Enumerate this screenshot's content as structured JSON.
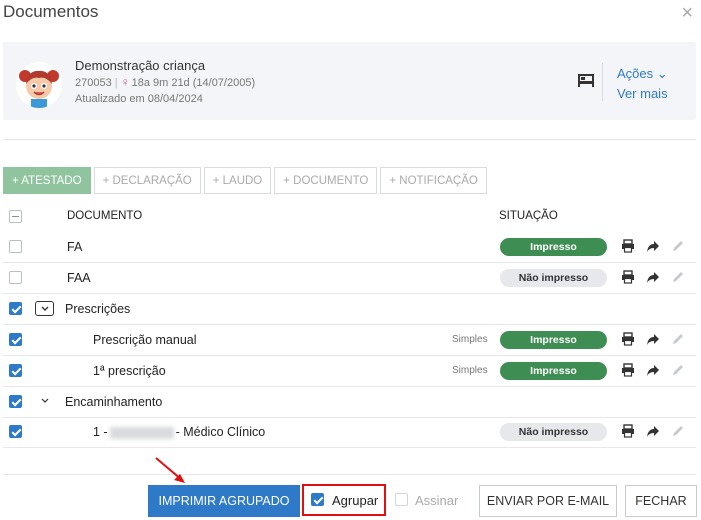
{
  "dialog": {
    "title": "Documentos",
    "close_symbol": "×"
  },
  "patient": {
    "name": "Demonstração criança",
    "id": "270053",
    "id_separator": "|",
    "age": "18a 9m 21d (14/07/2005)",
    "updated": "Atualizado em 08/04/2024",
    "gender_icon": "female-icon",
    "actions_label": "Ações",
    "see_more_label": "Ver mais"
  },
  "toolbar": {
    "buttons": [
      {
        "label": "+ ATESTADO"
      },
      {
        "label": "+ DECLARAÇÃO"
      },
      {
        "label": "+ LAUDO"
      },
      {
        "label": "+ DOCUMENTO"
      },
      {
        "label": "+ NOTIFICAÇÃO"
      }
    ]
  },
  "table": {
    "headers": {
      "document": "DOCUMENTO",
      "status": "SITUAÇÃO"
    },
    "rows": [
      {
        "name": "FA",
        "checked": false,
        "status": "Impresso",
        "printed": true
      },
      {
        "name": "FAA",
        "checked": false,
        "status": "Não impresso",
        "printed": false
      },
      {
        "name": "Prescrições",
        "checked": true,
        "group": true
      },
      {
        "name": "Prescrição manual",
        "checked": true,
        "tag": "Simples",
        "status": "Impresso",
        "printed": true
      },
      {
        "name": "1ª prescrição",
        "checked": true,
        "tag": "Simples",
        "status": "Impresso",
        "printed": true
      },
      {
        "name": "Encaminhamento",
        "checked": true,
        "group": true
      },
      {
        "name_prefix": "1 -",
        "name_suffix": "- Médico Clínico",
        "checked": true,
        "status": "Não impresso",
        "printed": false
      }
    ]
  },
  "footer": {
    "print_grouped": "IMPRIMIR AGRUPADO",
    "group_label": "Agrupar",
    "group_checked": true,
    "sign_label": "Assinar",
    "sign_checked": false,
    "send_email": "ENVIAR POR E-MAIL",
    "close": "FECHAR"
  },
  "colors": {
    "primary": "#2f7ac8",
    "printed": "#3e8e53",
    "not_printed": "#e6e8eb",
    "add_button": "#90c49e",
    "highlight": "#e01010"
  }
}
